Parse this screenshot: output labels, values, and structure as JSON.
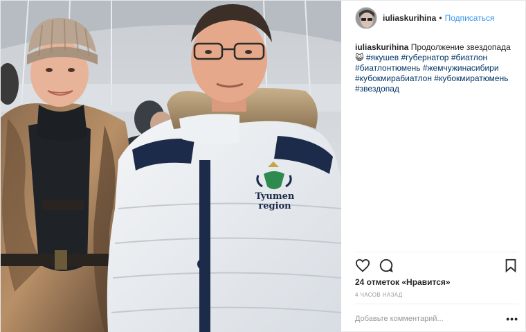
{
  "post": {
    "author": {
      "username": "iuliaskurihina",
      "separator": "•",
      "follow_label": "Подписаться"
    },
    "caption": {
      "username": "iuliaskurihina",
      "text": "Продолжение звездопада 😺",
      "hashtags": [
        "#якушев",
        "#губернатор",
        "#биатлон",
        "#биатлонтюмень",
        "#жемчужинасибири",
        "#кубокмирабиатлон",
        "#кубокмиратюмень",
        "#звездопад"
      ]
    },
    "photo": {
      "jacket_logo_line1": "Tyumen",
      "jacket_logo_line2": "region"
    },
    "actions": {
      "like_icon": "heart-outline-icon",
      "comment_icon": "speech-bubble-icon",
      "save_icon": "bookmark-icon"
    },
    "likes_text": "24 отметок «Нравится»",
    "time_text": "4 часов назад",
    "comment": {
      "placeholder": "Добавьте комментарий...",
      "more_label": "•••"
    },
    "colors": {
      "link_blue": "#3897f0",
      "hashtag_blue": "#003569",
      "text": "#262626",
      "muted": "#999999",
      "divider": "#efefef"
    }
  }
}
